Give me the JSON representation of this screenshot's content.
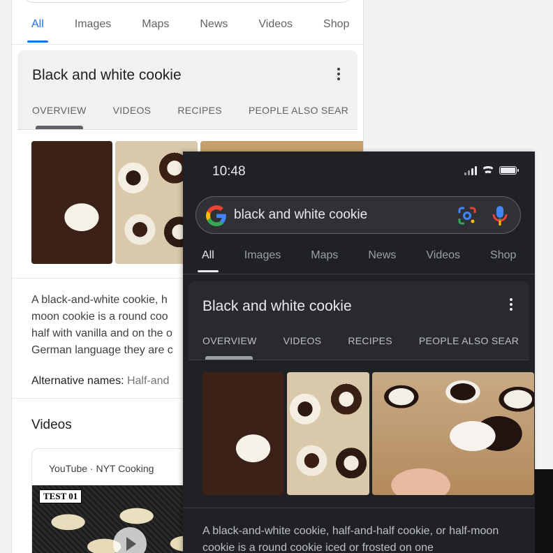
{
  "light_phone": {
    "tabs": [
      "All",
      "Images",
      "Maps",
      "News",
      "Videos",
      "Shop"
    ],
    "card": {
      "title": "Black and white cookie",
      "subtabs": [
        "OVERVIEW",
        "VIDEOS",
        "RECIPES",
        "PEOPLE ALSO SEAR"
      ]
    },
    "snippet_lines": [
      "A black-and-white cookie, h",
      "moon cookie is a round coo",
      "half with vanilla and on the o",
      "German language they are c"
    ],
    "alt_names_label": "Alternative names:",
    "alt_names_value": "Half-and",
    "videos_heading": "Videos",
    "video": {
      "source": "YouTube · NYT Cooking",
      "thumb_label": "TEST 01"
    }
  },
  "dark_phone": {
    "time": "10:48",
    "search_query": "black and white cookie",
    "tabs": [
      "All",
      "Images",
      "Maps",
      "News",
      "Videos",
      "Shop"
    ],
    "card": {
      "title": "Black and white cookie",
      "subtabs": [
        "OVERVIEW",
        "VIDEOS",
        "RECIPES",
        "PEOPLE ALSO SEAR"
      ]
    },
    "snippet": "A black-and-white cookie, half-and-half cookie, or half-moon cookie is a round cookie iced or frosted on one"
  },
  "colors": {
    "google_blue": "#1a73e8",
    "google_red": "#ea4335",
    "google_yellow": "#fbbc05",
    "google_green": "#34a853",
    "dark_bg": "#202124"
  },
  "icons": [
    "kebab-menu-icon",
    "google-logo-icon",
    "lens-icon",
    "mic-icon",
    "signal-icon",
    "wifi-icon",
    "battery-icon",
    "play-icon"
  ]
}
